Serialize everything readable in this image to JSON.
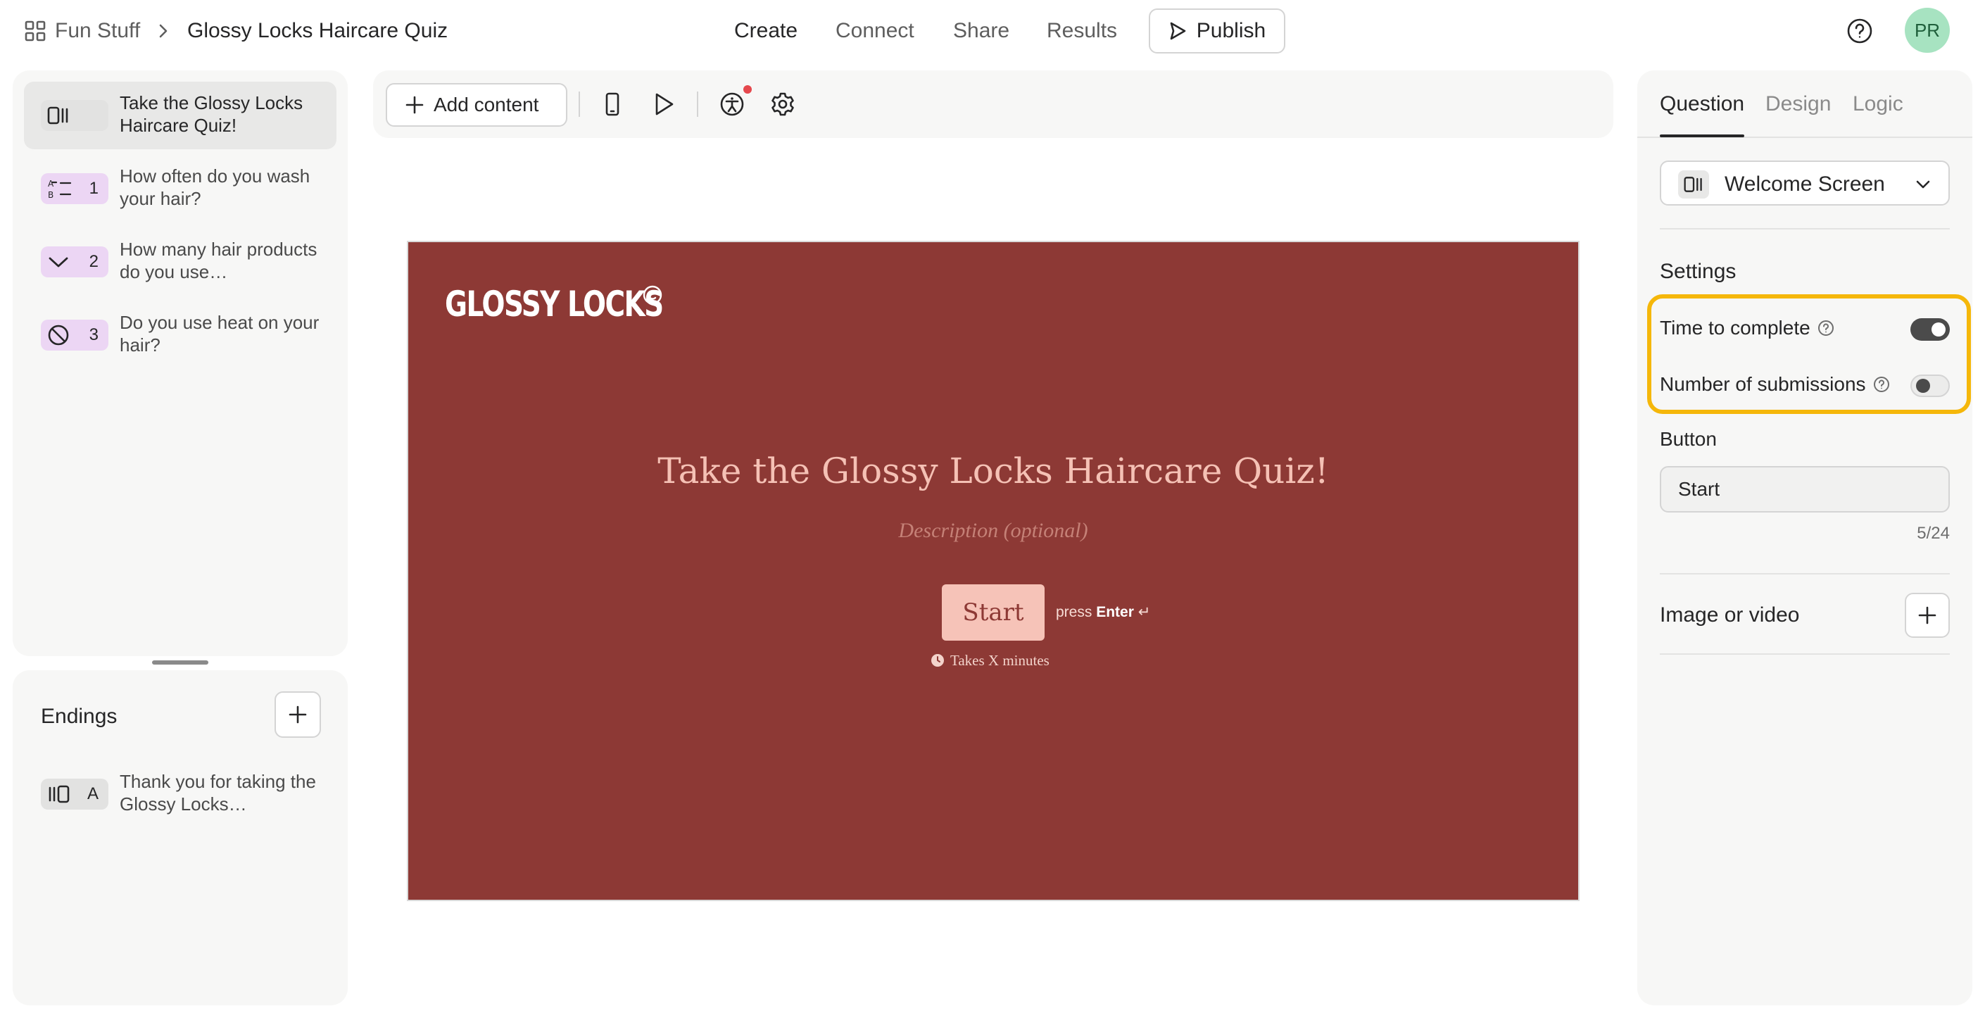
{
  "breadcrumb": {
    "workspace": "Fun Stuff",
    "form": "Glossy Locks Haircare Quiz"
  },
  "nav": {
    "create": "Create",
    "connect": "Connect",
    "share": "Share",
    "results": "Results",
    "publish": "Publish"
  },
  "user": {
    "initials": "PR"
  },
  "questions": [
    {
      "num": "",
      "text": "Take the Glossy Locks Haircare Quiz!",
      "icon": "welcome-screen-icon"
    },
    {
      "num": "1",
      "text": "How often do you wash your hair?",
      "icon": "multiple-choice-icon"
    },
    {
      "num": "2",
      "text": "How many hair products do you use…",
      "icon": "dropdown-icon"
    },
    {
      "num": "3",
      "text": "Do you use heat on your hair?",
      "icon": "yes-no-icon"
    }
  ],
  "endings": {
    "title": "Endings",
    "items": [
      {
        "num": "A",
        "text": "Thank you for taking the Glossy Locks…",
        "icon": "ending-screen-icon"
      }
    ]
  },
  "toolbar": {
    "add_content": "Add content"
  },
  "preview": {
    "logo": "GLOSSY LOCKS",
    "title": "Take the Glossy Locks Haircare Quiz!",
    "description_placeholder": "Description (optional)",
    "button": "Start",
    "press": "press",
    "enter": "Enter",
    "enter_glyph": "↵",
    "time": "Takes X minutes"
  },
  "right_panel": {
    "tabs": {
      "question": "Question",
      "design": "Design",
      "logic": "Logic"
    },
    "type": "Welcome Screen",
    "settings_title": "Settings",
    "time_to_complete": {
      "label": "Time to complete",
      "on": true
    },
    "number_of_submissions": {
      "label": "Number of submissions",
      "on": false
    },
    "button_label": "Button",
    "button_value": "Start",
    "char_count": "5/24",
    "media_title": "Image or video"
  },
  "colors": {
    "canvas_bg": "#8d3935",
    "title_color": "#f5c1b5",
    "button_bg": "#f6c3b8",
    "question_badge": "#ecd6f4",
    "highlight": "#f5b70a"
  }
}
